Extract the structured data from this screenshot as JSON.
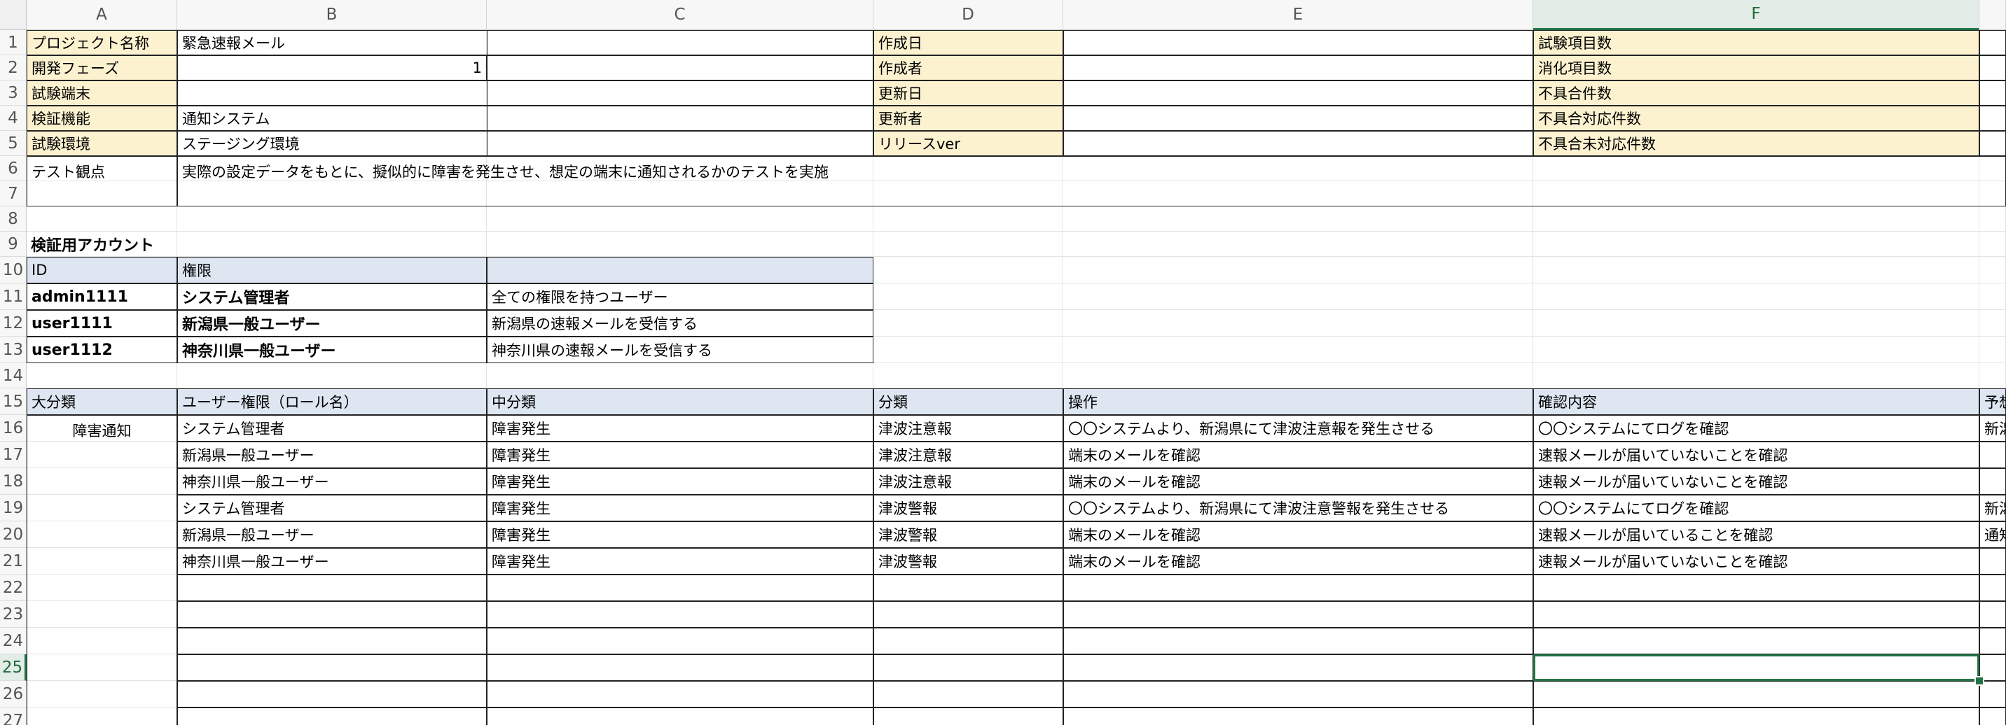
{
  "columns": [
    "A",
    "B",
    "C",
    "D",
    "E",
    "F"
  ],
  "rows": [
    "1",
    "2",
    "3",
    "4",
    "5",
    "6",
    "7",
    "8",
    "9",
    "10",
    "11",
    "12",
    "13",
    "14",
    "15",
    "16",
    "17",
    "18",
    "19",
    "20",
    "21",
    "22",
    "23",
    "24",
    "25",
    "26",
    "27"
  ],
  "header_block": {
    "project_label": "プロジェクト名称",
    "project_value": "緊急速報メール",
    "phase_label": "開発フェーズ",
    "phase_value": "1",
    "device_label": "試験端末",
    "device_value": "",
    "feature_label": "検証機能",
    "feature_value": "通知システム",
    "env_label": "試験環境",
    "env_value": "ステージング環境",
    "created_label": "作成日",
    "author_label": "作成者",
    "updated_label": "更新日",
    "updater_label": "更新者",
    "release_label": "リリースver",
    "count_total_label": "試験項目数",
    "count_done_label": "消化項目数",
    "bug_label": "不具合件数",
    "bug_fixed_label": "不具合対応件数",
    "bug_open_label": "不具合未対応件数",
    "viewpoint_label": "テスト観点",
    "viewpoint_value": "実際の設定データをもとに、擬似的に障害を発生させ、想定の端末に通知されるかのテストを実施"
  },
  "accounts": {
    "title": "検証用アカウント",
    "col_id": "ID",
    "col_role": "権限",
    "items": [
      {
        "id": "admin1111",
        "role": "システム管理者",
        "desc": "全ての権限を持つユーザー"
      },
      {
        "id": "user1111",
        "role": "新潟県一般ユーザー",
        "desc": "新潟県の速報メールを受信する"
      },
      {
        "id": "user1112",
        "role": "神奈川県一般ユーザー",
        "desc": "神奈川県の速報メールを受信する"
      }
    ]
  },
  "cases": {
    "headers": [
      "大分類",
      "ユーザー権限（ロール名）",
      "中分類",
      "分類",
      "操作",
      "確認内容",
      "予想"
    ],
    "major": "障害通知",
    "rows": [
      {
        "role": "システム管理者",
        "mid": "障害発生",
        "cat": "津波注意報",
        "op": "〇〇システムより、新潟県にて津波注意報を発生させる",
        "check": "〇〇システムにてログを確認",
        "extra": "新潟"
      },
      {
        "role": "新潟県一般ユーザー",
        "mid": "障害発生",
        "cat": "津波注意報",
        "op": "端末のメールを確認",
        "check": "速報メールが届いていないことを確認",
        "extra": ""
      },
      {
        "role": "神奈川県一般ユーザー",
        "mid": "障害発生",
        "cat": "津波注意報",
        "op": "端末のメールを確認",
        "check": "速報メールが届いていないことを確認",
        "extra": ""
      },
      {
        "role": "システム管理者",
        "mid": "障害発生",
        "cat": "津波警報",
        "op": "〇〇システムより、新潟県にて津波注意警報を発生させる",
        "check": "〇〇システムにてログを確認",
        "extra": "新潟"
      },
      {
        "role": "新潟県一般ユーザー",
        "mid": "障害発生",
        "cat": "津波警報",
        "op": "端末のメールを確認",
        "check": "速報メールが届いていることを確認",
        "extra": "通知"
      },
      {
        "role": "神奈川県一般ユーザー",
        "mid": "障害発生",
        "cat": "津波警報",
        "op": "端末のメールを確認",
        "check": "速報メールが届いていないことを確認",
        "extra": ""
      }
    ]
  },
  "selected_cell": "F25",
  "colors": {
    "accent": "#217346",
    "yellow": "#fdf2d0",
    "blue": "#dde6f1"
  }
}
